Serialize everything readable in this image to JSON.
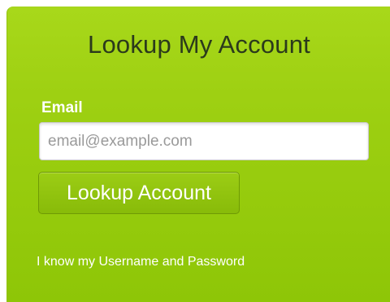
{
  "panel": {
    "title": "Lookup My Account",
    "email_label": "Email",
    "email_value": "",
    "email_placeholder": "email@example.com",
    "lookup_button_label": "Lookup Account",
    "alt_link_label": "I know my Username and Password"
  },
  "colors": {
    "panel_green": "#9ed012",
    "button_green": "#88bb09",
    "title_text": "#2b3a1c",
    "label_text": "#ffffff"
  }
}
